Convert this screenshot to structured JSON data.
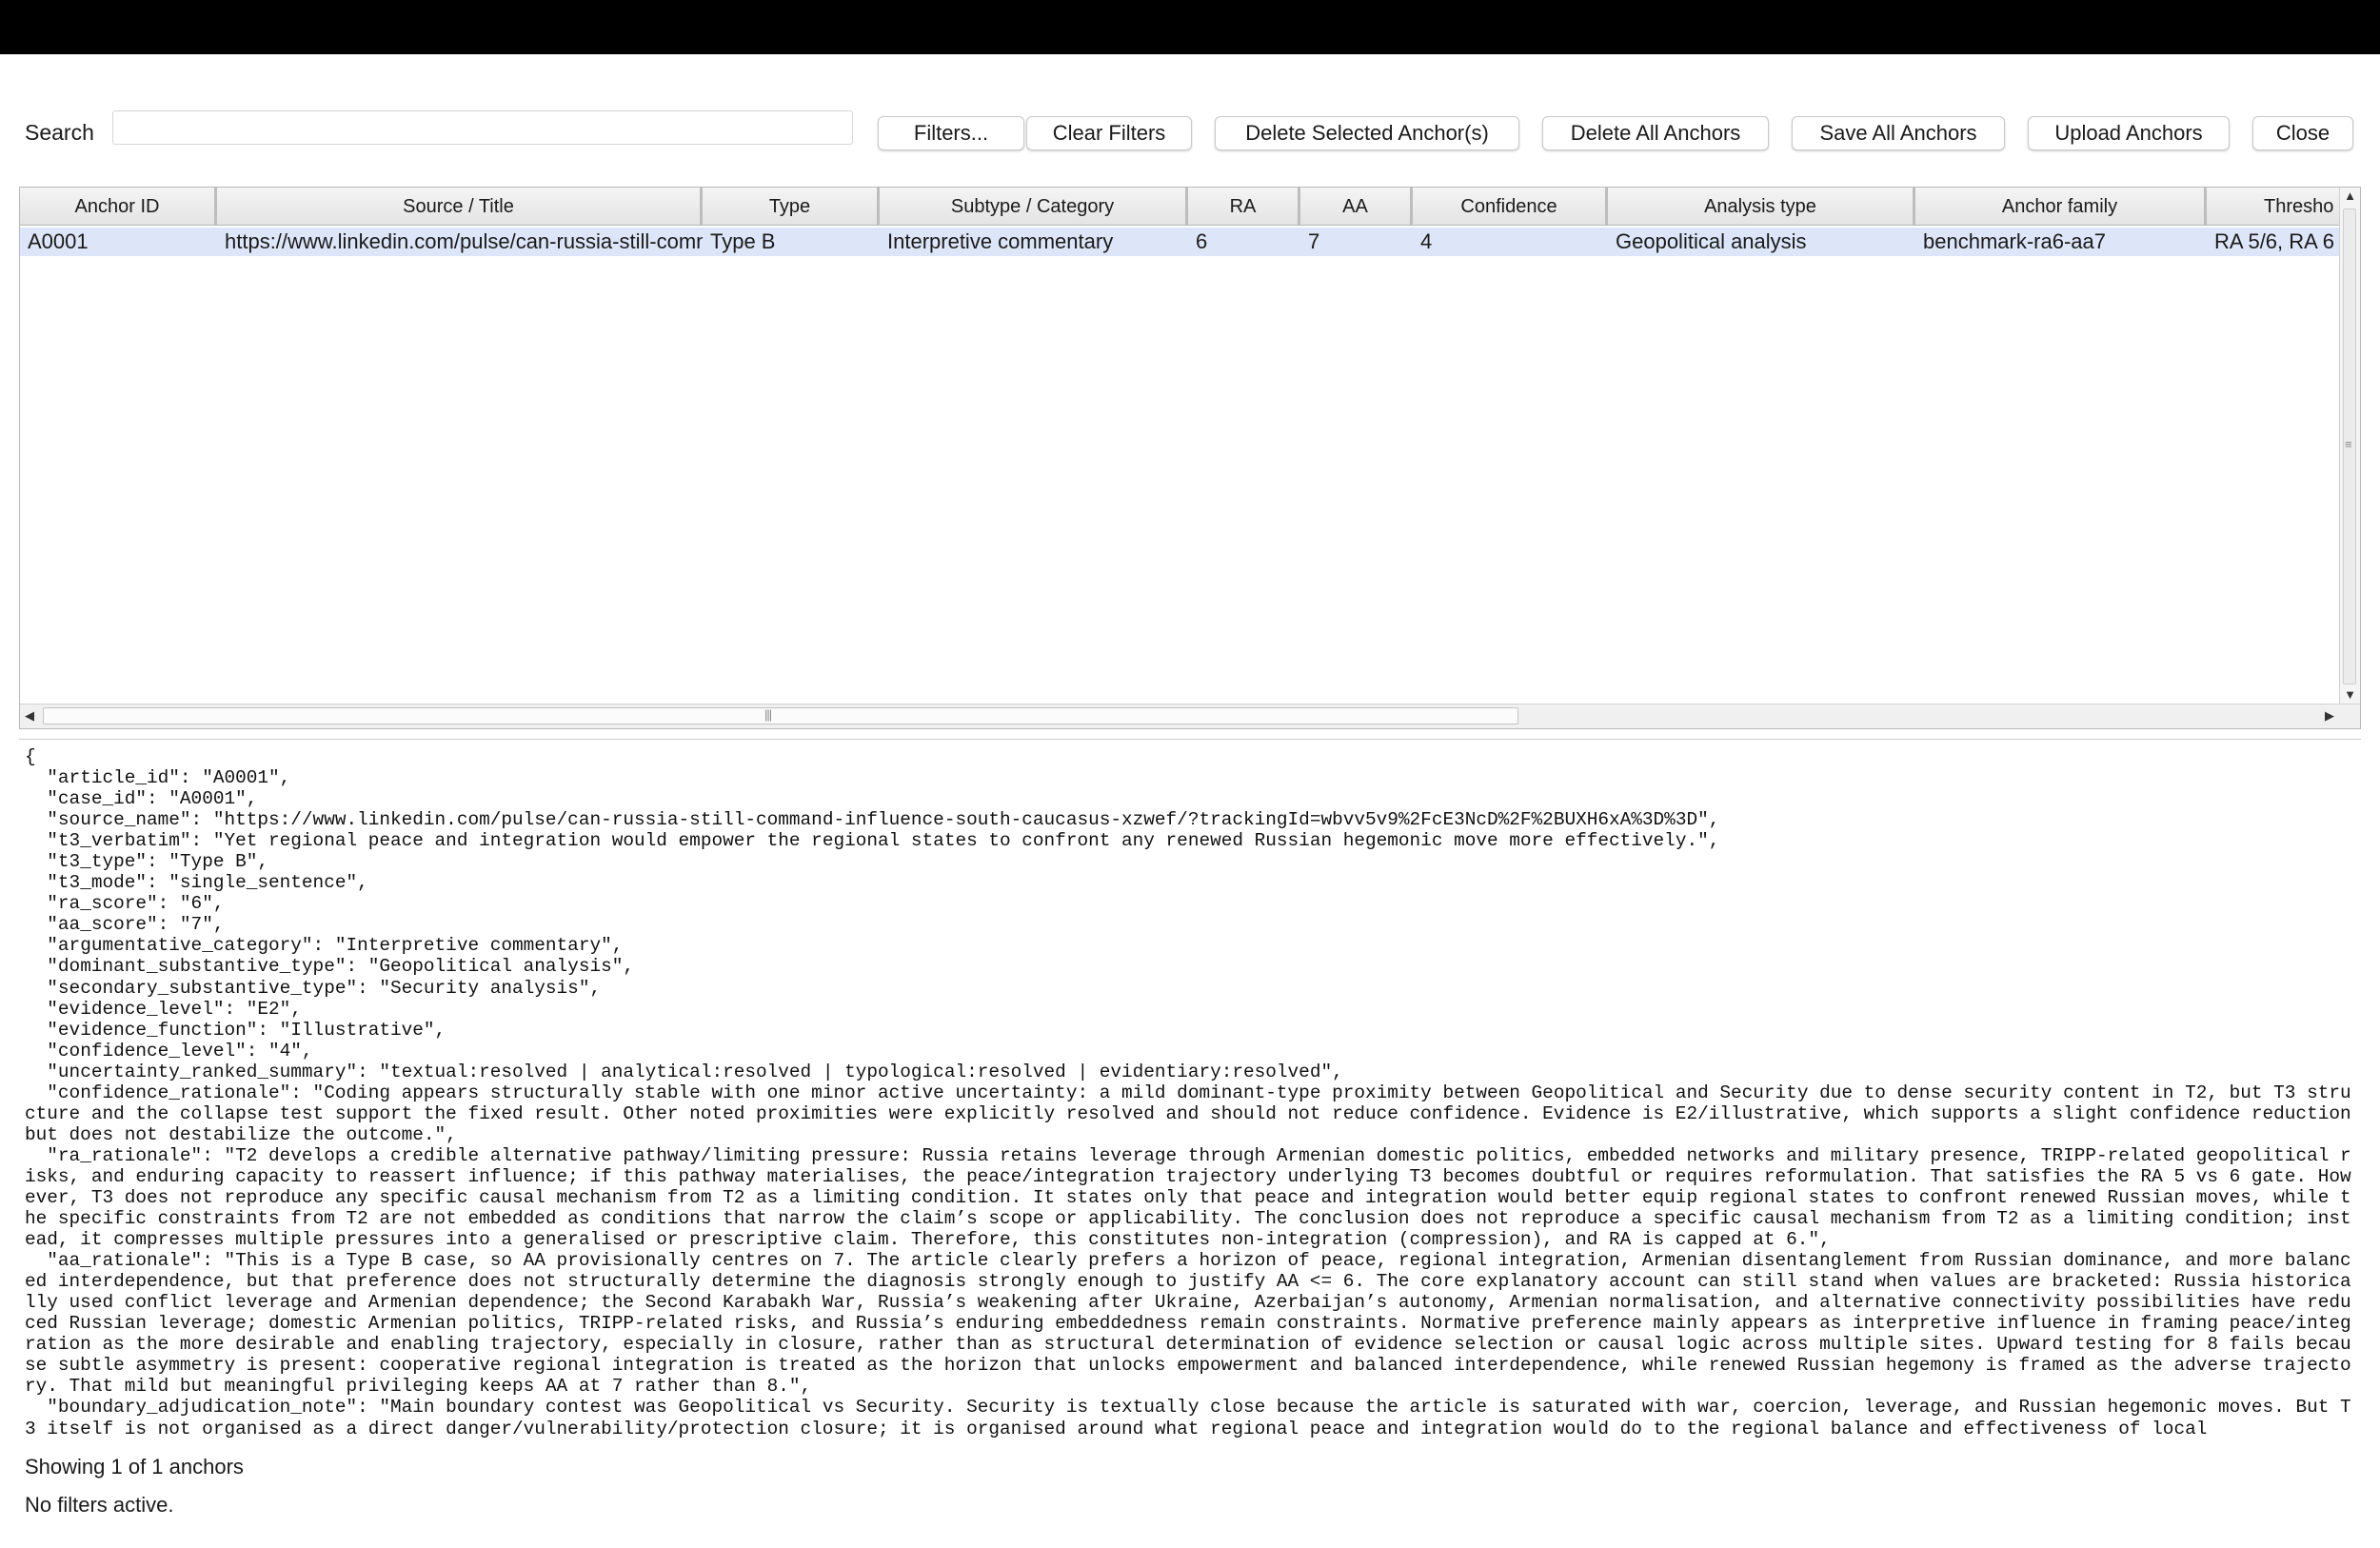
{
  "search": {
    "label": "Search",
    "value": "",
    "placeholder": ""
  },
  "toolbar": {
    "filters": "Filters...",
    "clear_filters": "Clear Filters",
    "delete_selected": "Delete Selected Anchor(s)",
    "delete_all": "Delete All Anchors",
    "save_all": "Save All Anchors",
    "upload": "Upload Anchors",
    "close": "Close"
  },
  "table": {
    "columns": [
      "Anchor ID",
      "Source / Title",
      "Type",
      "Subtype / Category",
      "RA",
      "AA",
      "Confidence",
      "Analysis type",
      "Anchor family",
      "Thresho"
    ],
    "rows": [
      [
        "A0001",
        "https://www.linkedin.com/pulse/can-russia-still-command-influence-south-caucasus-xzwef/",
        "Type B",
        "Interpretive commentary",
        "6",
        "7",
        "4",
        "Geopolitical analysis",
        "benchmark-ra6-aa7",
        "RA 5/6, RA 6"
      ]
    ]
  },
  "detail": {
    "text": "{\n  \"article_id\": \"A0001\",\n  \"case_id\": \"A0001\",\n  \"source_name\": \"https://www.linkedin.com/pulse/can-russia-still-command-influence-south-caucasus-xzwef/?trackingId=wbvv5v9%2FcE3NcD%2F%2BUXH6xA%3D%3D\",\n  \"t3_verbatim\": \"Yet regional peace and integration would empower the regional states to confront any renewed Russian hegemonic move more effectively.\",\n  \"t3_type\": \"Type B\",\n  \"t3_mode\": \"single_sentence\",\n  \"ra_score\": \"6\",\n  \"aa_score\": \"7\",\n  \"argumentative_category\": \"Interpretive commentary\",\n  \"dominant_substantive_type\": \"Geopolitical analysis\",\n  \"secondary_substantive_type\": \"Security analysis\",\n  \"evidence_level\": \"E2\",\n  \"evidence_function\": \"Illustrative\",\n  \"confidence_level\": \"4\",\n  \"uncertainty_ranked_summary\": \"textual:resolved | analytical:resolved | typological:resolved | evidentiary:resolved\",\n  \"confidence_rationale\": \"Coding appears structurally stable with one minor active uncertainty: a mild dominant-type proximity between Geopolitical and Security due to dense security content in T2, but T3 structure and the collapse test support the fixed result. Other noted proximities were explicitly resolved and should not reduce confidence. Evidence is E2/illustrative, which supports a slight confidence reduction but does not destabilize the outcome.\",\n  \"ra_rationale\": \"T2 develops a credible alternative pathway/limiting pressure: Russia retains leverage through Armenian domestic politics, embedded networks and military presence, TRIPP-related geopolitical risks, and enduring capacity to reassert influence; if this pathway materialises, the peace/integration trajectory underlying T3 becomes doubtful or requires reformulation. That satisfies the RA 5 vs 6 gate. However, T3 does not reproduce any specific causal mechanism from T2 as a limiting condition. It states only that peace and integration would better equip regional states to confront renewed Russian moves, while the specific constraints from T2 are not embedded as conditions that narrow the claim’s scope or applicability. The conclusion does not reproduce a specific causal mechanism from T2 as a limiting condition; instead, it compresses multiple pressures into a generalised or prescriptive claim. Therefore, this constitutes non-integration (compression), and RA is capped at 6.\",\n  \"aa_rationale\": \"This is a Type B case, so AA provisionally centres on 7. The article clearly prefers a horizon of peace, regional integration, Armenian disentanglement from Russian dominance, and more balanced interdependence, but that preference does not structurally determine the diagnosis strongly enough to justify AA <= 6. The core explanatory account can still stand when values are bracketed: Russia historically used conflict leverage and Armenian dependence; the Second Karabakh War, Russia’s weakening after Ukraine, Azerbaijan’s autonomy, Armenian normalisation, and alternative connectivity possibilities have reduced Russian leverage; domestic Armenian politics, TRIPP-related risks, and Russia’s enduring embeddedness remain constraints. Normative preference mainly appears as interpretive influence in framing peace/integration as the more desirable and enabling trajectory, especially in closure, rather than as structural determination of evidence selection or causal logic across multiple sites. Upward testing for 8 fails because subtle asymmetry is present: cooperative regional integration is treated as the horizon that unlocks empowerment and balanced interdependence, while renewed Russian hegemony is framed as the adverse trajectory. That mild but meaningful privileging keeps AA at 7 rather than 8.\",\n  \"boundary_adjudication_note\": \"Main boundary contest was Geopolitical vs Security. Security is textually close because the article is saturated with war, coercion, leverage, and Russian hegemonic moves. But T3 itself is not organised as a direct danger/vulnerability/protection closure; it is organised around what regional peace and integration would do to the regional balance and effectiveness of local"
  },
  "status": {
    "showing": "Showing 1 of 1 anchors",
    "filters": "No filters active."
  }
}
